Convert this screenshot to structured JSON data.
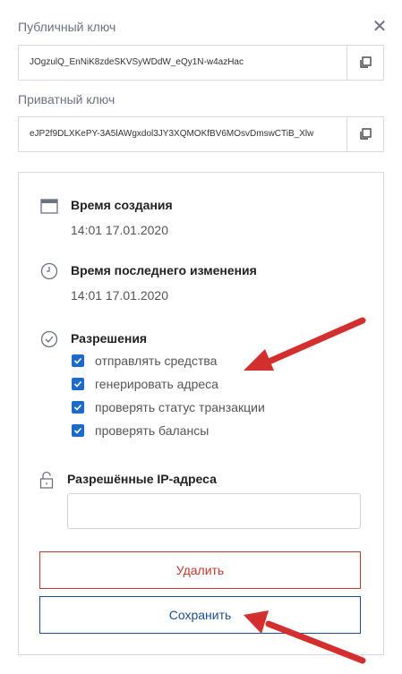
{
  "public_key": {
    "label": "Публичный ключ",
    "value": "JOgzulQ_EnNiK8zdeSKVSyWDdW_eQy1N-w4azHac"
  },
  "private_key": {
    "label": "Приватный ключ",
    "value": "eJP2f9DLXKePY-3A5lAWgxdol3JY3XQMOKfBV6MOsvDmswCTiB_Xlw"
  },
  "close": {
    "symbol": "✕"
  },
  "created": {
    "title": "Время создания",
    "value": "14:01 17.01.2020"
  },
  "modified": {
    "title": "Время последнего изменения",
    "value": "14:01 17.01.2020"
  },
  "permissions": {
    "title": "Разрешения",
    "items": [
      {
        "label": "отправлять средства",
        "checked": true
      },
      {
        "label": "генерировать адреса",
        "checked": true
      },
      {
        "label": "проверять статус транзакции",
        "checked": true
      },
      {
        "label": "проверять балансы",
        "checked": true
      }
    ]
  },
  "ip": {
    "title": "Разрешённые IP-адреса",
    "value": ""
  },
  "buttons": {
    "delete": "Удалить",
    "save": "Сохранить"
  },
  "colors": {
    "accent": "#1c6bc9",
    "danger": "#c0392b",
    "primary_dark": "#1c4f8f",
    "arrow": "#d32f2f"
  },
  "icons": [
    "close-icon",
    "copy-icon",
    "calendar-icon",
    "clock-icon",
    "check-circle-icon",
    "lock-icon",
    "checkmark-icon",
    "arrow-icon"
  ]
}
